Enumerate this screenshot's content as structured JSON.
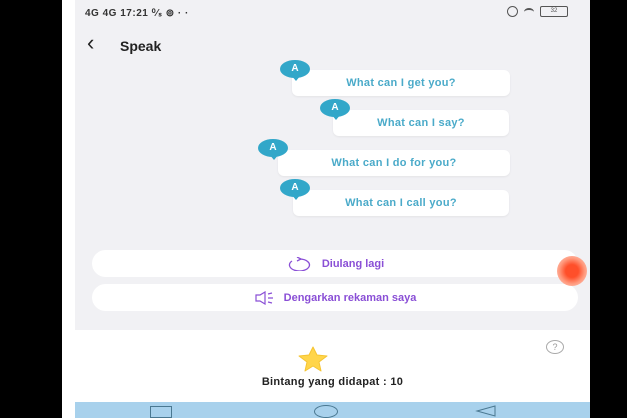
{
  "status": {
    "left": "4G 4G 17:21 ⁰⁄ₛ ⊚ · ·",
    "battery": "32"
  },
  "header": {
    "title": "Speak"
  },
  "avatar_letter": "A",
  "phrases": [
    "What can I get you?",
    "What can I say?",
    "What can I do for you?",
    "What can I call you?"
  ],
  "actions": {
    "repeat_label": "Diulang lagi",
    "listen_label": "Dengarkan rekaman saya"
  },
  "bottom": {
    "help": "?",
    "stars_text": "Bintang yang didapat : 10"
  },
  "colors": {
    "accent_purple": "#8a4fd6",
    "bubble_text": "#4aaac9",
    "avatar": "#32a7c9",
    "star": "#ffd54a"
  }
}
